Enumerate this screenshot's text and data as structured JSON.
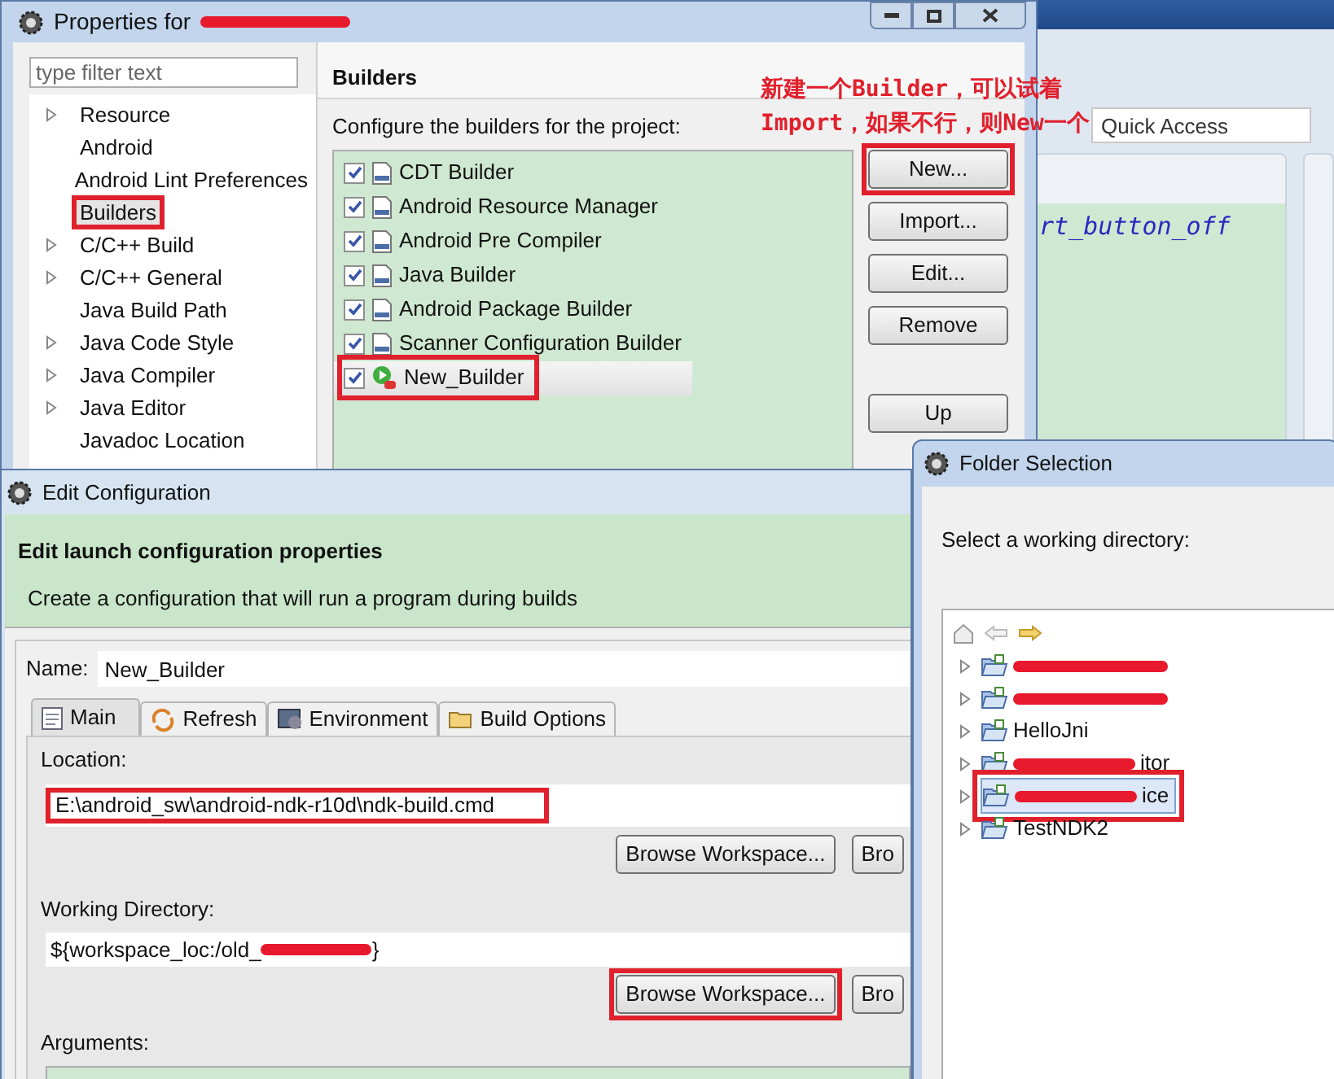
{
  "ide_background": {
    "quick_access": {
      "placeholder": "Quick Access"
    },
    "editor_text": "rt_button_off"
  },
  "properties_window": {
    "title": "Properties for",
    "filter": {
      "placeholder": "type filter text"
    },
    "tree": [
      {
        "label": "Resource",
        "expandable": true,
        "selected": false,
        "highlighted": false
      },
      {
        "label": "Android",
        "expandable": false,
        "selected": false,
        "highlighted": false
      },
      {
        "label": "Android Lint Preferences",
        "expandable": false,
        "selected": false,
        "highlighted": false
      },
      {
        "label": "Builders",
        "expandable": false,
        "selected": true,
        "highlighted": true
      },
      {
        "label": "C/C++ Build",
        "expandable": true,
        "selected": false,
        "highlighted": false
      },
      {
        "label": "C/C++ General",
        "expandable": true,
        "selected": false,
        "highlighted": false
      },
      {
        "label": "Java Build Path",
        "expandable": false,
        "selected": false,
        "highlighted": false
      },
      {
        "label": "Java Code Style",
        "expandable": true,
        "selected": false,
        "highlighted": false
      },
      {
        "label": "Java Compiler",
        "expandable": true,
        "selected": false,
        "highlighted": false
      },
      {
        "label": "Java Editor",
        "expandable": true,
        "selected": false,
        "highlighted": false
      },
      {
        "label": "Javadoc Location",
        "expandable": false,
        "selected": false,
        "highlighted": false
      }
    ],
    "page_title": "Builders",
    "description": "Configure the builders for the project:",
    "builders": [
      {
        "label": "CDT Builder",
        "checked": true,
        "kind": "binary",
        "selected": false,
        "highlighted": false
      },
      {
        "label": "Android Resource Manager",
        "checked": true,
        "kind": "binary",
        "selected": false,
        "highlighted": false
      },
      {
        "label": "Android Pre Compiler",
        "checked": true,
        "kind": "binary",
        "selected": false,
        "highlighted": false
      },
      {
        "label": "Java Builder",
        "checked": true,
        "kind": "binary",
        "selected": false,
        "highlighted": false
      },
      {
        "label": "Android Package Builder",
        "checked": true,
        "kind": "binary",
        "selected": false,
        "highlighted": false
      },
      {
        "label": "Scanner Configuration Builder",
        "checked": true,
        "kind": "binary",
        "selected": false,
        "highlighted": false
      },
      {
        "label": "New_Builder",
        "checked": true,
        "kind": "launch",
        "selected": true,
        "highlighted": true
      }
    ],
    "buttons": [
      {
        "label": "New...",
        "highlighted": true
      },
      {
        "label": "Import...",
        "highlighted": false
      },
      {
        "label": "Edit...",
        "highlighted": false
      },
      {
        "label": "Remove",
        "highlighted": false
      },
      {
        "label": "Up",
        "highlighted": false
      }
    ]
  },
  "annotation": [
    "新建一个Builder，可以试着",
    "Import，如果不行，则New一个"
  ],
  "edit_configuration": {
    "title": "Edit Configuration",
    "heading": "Edit launch configuration properties",
    "subtitle": "Create a configuration that will run a program during builds",
    "name_label": "Name:",
    "name_value": "New_Builder",
    "tabs": [
      {
        "label": "Main",
        "kind": "main",
        "selected": true
      },
      {
        "label": "Refresh",
        "kind": "refresh",
        "selected": false
      },
      {
        "label": "Environment",
        "kind": "environment",
        "selected": false
      },
      {
        "label": "Build Options",
        "kind": "folder",
        "selected": false
      }
    ],
    "location": {
      "label": "Location:",
      "value": "E:\\android_sw\\android-ndk-r10d\\ndk-build.cmd",
      "highlighted": true,
      "buttons": [
        {
          "label": "Browse Workspace...",
          "highlighted": false
        },
        {
          "label": "Bro",
          "highlighted": false
        }
      ]
    },
    "working_directory": {
      "label": "Working Directory:",
      "value_start": "${workspace_loc:/old_",
      "value_end": "}",
      "highlighted": false,
      "buttons": [
        {
          "label": "Browse Workspace...",
          "highlighted": true
        },
        {
          "label": "Bro",
          "highlighted": false
        }
      ]
    },
    "arguments": {
      "label": "Arguments:"
    }
  },
  "folder_selection": {
    "title": "Folder Selection",
    "prompt": "Select a working directory:",
    "items": [
      {
        "redacted": true,
        "selected": false,
        "highlighted": false
      },
      {
        "redacted": true,
        "selected": false,
        "highlighted": false
      },
      {
        "label": "HelloJni",
        "redacted": false,
        "selected": false,
        "highlighted": false
      },
      {
        "label": "itor",
        "redacted": true,
        "selected": false,
        "highlighted": false
      },
      {
        "label": "ice",
        "redacted": true,
        "selected": true,
        "highlighted": true
      },
      {
        "label": "TestNDK2",
        "redacted": false,
        "selected": false,
        "highlighted": false
      }
    ]
  }
}
